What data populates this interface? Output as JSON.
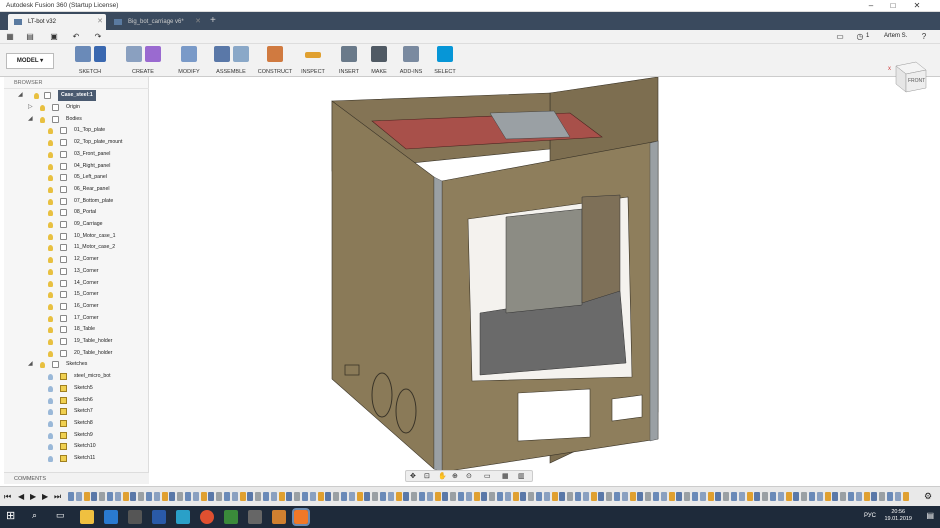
{
  "window": {
    "title": "Autodesk Fusion 360 (Startup License)"
  },
  "tabs": [
    {
      "label": "LT-bot v32",
      "active": true
    },
    {
      "label": "Big_bot_carriage v6*",
      "active": false
    }
  ],
  "quick_access": {
    "user": "Artem S.",
    "jobs": "1"
  },
  "toolbar": {
    "workspace": "MODEL",
    "groups": [
      "SKETCH",
      "CREATE",
      "MODIFY",
      "ASSEMBLE",
      "CONSTRUCT",
      "INSPECT",
      "INSERT",
      "MAKE",
      "ADD-INS",
      "SELECT"
    ]
  },
  "browser": {
    "header": "BROWSER",
    "root": "Case_steel:1",
    "items": [
      {
        "label": "Origin",
        "kind": "folder",
        "level": 1
      },
      {
        "label": "Bodies",
        "kind": "folder",
        "level": 1
      },
      {
        "label": "01_Top_plate",
        "kind": "body"
      },
      {
        "label": "02_Top_plate_mount",
        "kind": "body"
      },
      {
        "label": "03_Front_panel",
        "kind": "body"
      },
      {
        "label": "04_Right_panel",
        "kind": "body"
      },
      {
        "label": "05_Left_panel",
        "kind": "body"
      },
      {
        "label": "06_Rear_panel",
        "kind": "body"
      },
      {
        "label": "07_Bottom_plate",
        "kind": "body"
      },
      {
        "label": "08_Portal",
        "kind": "body"
      },
      {
        "label": "09_Carriage",
        "kind": "body"
      },
      {
        "label": "10_Motor_case_1",
        "kind": "body"
      },
      {
        "label": "11_Motor_case_2",
        "kind": "body"
      },
      {
        "label": "12_Corner",
        "kind": "body"
      },
      {
        "label": "13_Corner",
        "kind": "body"
      },
      {
        "label": "14_Corner",
        "kind": "body"
      },
      {
        "label": "15_Corner",
        "kind": "body"
      },
      {
        "label": "16_Corner",
        "kind": "body"
      },
      {
        "label": "17_Corner",
        "kind": "body"
      },
      {
        "label": "18_Table",
        "kind": "body"
      },
      {
        "label": "19_Table_holder",
        "kind": "body"
      },
      {
        "label": "20_Table_holder",
        "kind": "body"
      },
      {
        "label": "Sketches",
        "kind": "folder",
        "level": 1
      },
      {
        "label": "steel_micro_bot",
        "kind": "sketch"
      },
      {
        "label": "Sketch5",
        "kind": "sketch"
      },
      {
        "label": "Sketch6",
        "kind": "sketch"
      },
      {
        "label": "Sketch7",
        "kind": "sketch"
      },
      {
        "label": "Sketch8",
        "kind": "sketch"
      },
      {
        "label": "Sketch9",
        "kind": "sketch"
      },
      {
        "label": "Sketch10",
        "kind": "sketch"
      },
      {
        "label": "Sketch11",
        "kind": "sketch"
      }
    ]
  },
  "comments": {
    "label": "COMMENTS"
  },
  "viewcube": {
    "face": "FRONT"
  },
  "taskbar": {
    "lang": "РУС",
    "time": "20:56",
    "date": "19.01.2019"
  },
  "colors": {
    "panel": "#8a7a58",
    "panel_dark": "#6e6248",
    "plate_red": "#a8504a",
    "steel": "#9aa0a4",
    "accent": "#0696d7"
  }
}
